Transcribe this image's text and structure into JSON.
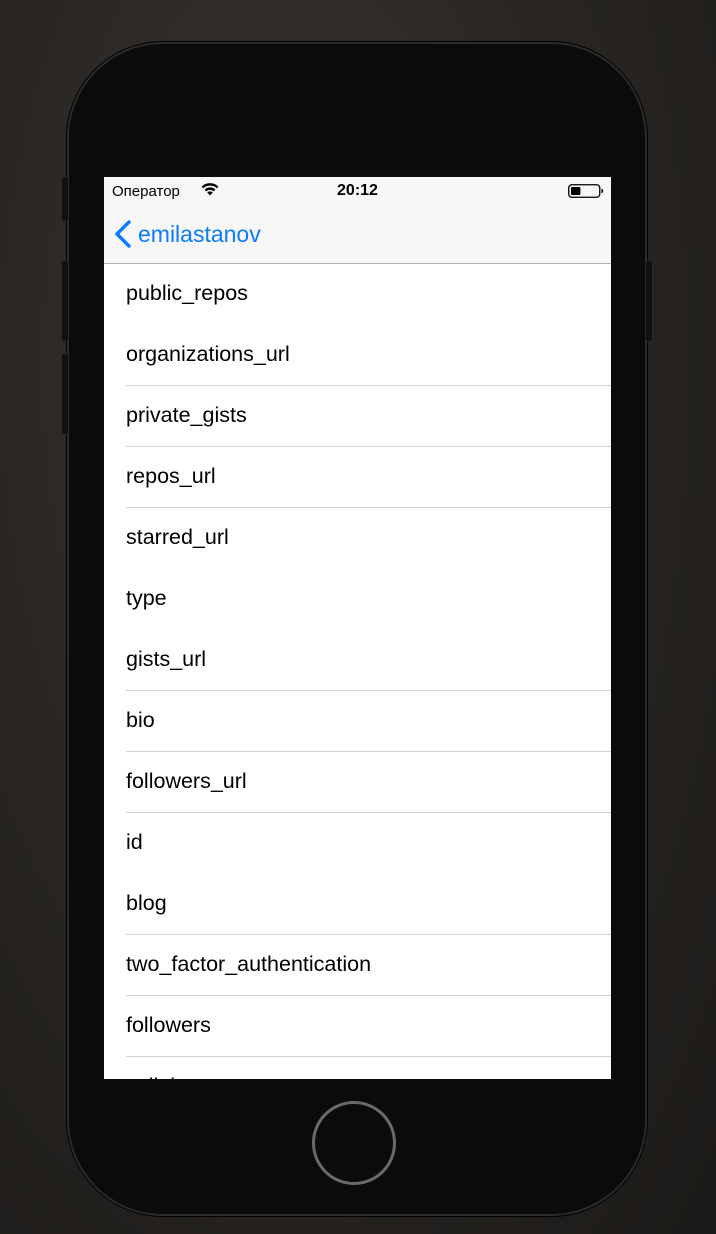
{
  "status_bar": {
    "carrier": "Оператор",
    "time": "20:12",
    "battery_level": 0.35
  },
  "nav_bar": {
    "back_label": "emilastanov",
    "back_icon": "chevron-left-icon",
    "accent_color": "#0a7aff"
  },
  "list": {
    "items": [
      {
        "label": "public_repos"
      },
      {
        "label": "organizations_url"
      },
      {
        "label": "private_gists"
      },
      {
        "label": "repos_url"
      },
      {
        "label": "starred_url"
      },
      {
        "label": "type"
      },
      {
        "label": "gists_url"
      },
      {
        "label": "bio"
      },
      {
        "label": "followers_url"
      },
      {
        "label": "id"
      },
      {
        "label": "blog"
      },
      {
        "label": "two_factor_authentication"
      },
      {
        "label": "followers"
      },
      {
        "label": "collaborators"
      }
    ]
  }
}
